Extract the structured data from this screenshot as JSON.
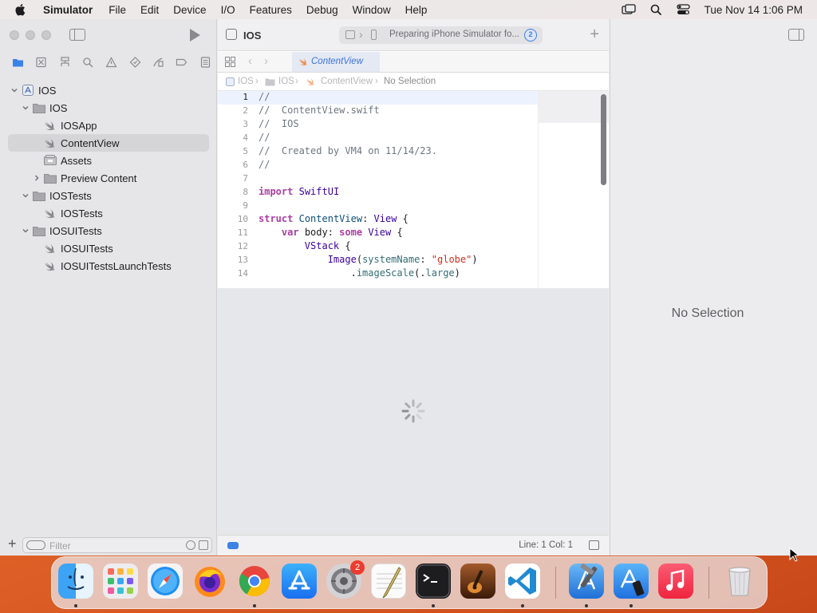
{
  "menubar": {
    "app_name": "Simulator",
    "menus": [
      "File",
      "Edit",
      "Device",
      "I/O",
      "Features",
      "Debug",
      "Window",
      "Help"
    ],
    "clock": "Tue Nov 14  1:06 PM",
    "status_icons": [
      "screen-mirroring-icon",
      "spotlight-search-icon",
      "control-center-icon"
    ]
  },
  "toolbar": {
    "project_title": "IOS",
    "activity_status": "Preparing iPhone Simulator fo...",
    "activity_badge": "2"
  },
  "navigator": {
    "tabs": [
      "folder-icon",
      "source-control-icon",
      "symbol-icon",
      "find-icon",
      "issue-icon",
      "test-icon",
      "debug-icon",
      "breakpoint-icon",
      "report-icon"
    ],
    "tree": [
      {
        "label": "IOS",
        "depth": 0,
        "kind": "project",
        "expanded": true
      },
      {
        "label": "IOS",
        "depth": 1,
        "kind": "folder",
        "expanded": true
      },
      {
        "label": "IOSApp",
        "depth": 2,
        "kind": "swift"
      },
      {
        "label": "ContentView",
        "depth": 2,
        "kind": "swift",
        "selected": true
      },
      {
        "label": "Assets",
        "depth": 2,
        "kind": "assets"
      },
      {
        "label": "Preview Content",
        "depth": 2,
        "kind": "folder",
        "expanded": false
      },
      {
        "label": "IOSTests",
        "depth": 1,
        "kind": "folder",
        "expanded": true
      },
      {
        "label": "IOSTests",
        "depth": 2,
        "kind": "swift"
      },
      {
        "label": "IOSUITests",
        "depth": 1,
        "kind": "folder",
        "expanded": true
      },
      {
        "label": "IOSUITests",
        "depth": 2,
        "kind": "swift"
      },
      {
        "label": "IOSUITestsLaunchTests",
        "depth": 2,
        "kind": "swift"
      }
    ],
    "filter_placeholder": "Filter"
  },
  "editor": {
    "active_tab": "ContentView",
    "jumpbar": [
      "IOS",
      "IOS",
      "ContentView",
      "No Selection"
    ],
    "current_line": 1,
    "lines": [
      {
        "n": "1",
        "t": "//"
      },
      {
        "n": "2",
        "t": "//  ContentView.swift"
      },
      {
        "n": "3",
        "t": "//  IOS"
      },
      {
        "n": "4",
        "t": "//"
      },
      {
        "n": "5",
        "t": "//  Created by VM4 on 11/14/23."
      },
      {
        "n": "6",
        "t": "//"
      },
      {
        "n": "7",
        "t": ""
      },
      {
        "n": "8",
        "t": "import SwiftUI"
      },
      {
        "n": "9",
        "t": ""
      },
      {
        "n": "10",
        "t": "struct ContentView: View {"
      },
      {
        "n": "11",
        "t": "    var body: some View {"
      },
      {
        "n": "12",
        "t": "        VStack {"
      },
      {
        "n": "13",
        "t": "            Image(systemName: \"globe\")"
      },
      {
        "n": "14",
        "t": "                .imageScale(.large)"
      }
    ],
    "status_line": "Line: 1",
    "status_col": "Col: 1"
  },
  "inspector": {
    "empty_text": "No Selection",
    "tabs": [
      "file-inspector-icon",
      "history-inspector-icon",
      "help-inspector-icon",
      "accessibility-inspector-icon",
      "attributes-inspector-icon"
    ]
  },
  "dock": {
    "apps": [
      "Finder",
      "Launchpad",
      "Safari",
      "Firefox",
      "Chrome",
      "App Store",
      "System Settings",
      "TextEdit",
      "Terminal",
      "GarageBand",
      "Visual Studio Code",
      "Xcode",
      "Simulator",
      "Music",
      "Trash"
    ],
    "settings_badge": "2"
  },
  "colors": {
    "accent": "#3b73d9",
    "selection": "#d5d5d8",
    "wallpaper": "#e86a2c",
    "badge": "#ec3b2f"
  }
}
